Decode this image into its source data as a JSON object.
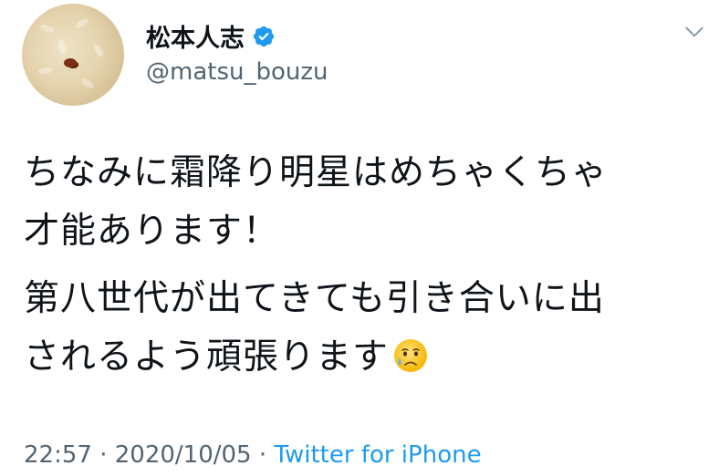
{
  "author": {
    "display_name": "松本人志",
    "handle": "@matsu_bouzu",
    "verified_icon": "verified-badge-icon",
    "avatar_icon": "avatar-image"
  },
  "menu": {
    "icon": "chevron-down-icon"
  },
  "tweet": {
    "paragraph_1_line_1": "ちなみに霜降り明星はめちゃくちゃ",
    "paragraph_1_line_2": "才能あります！",
    "paragraph_2_line_1": "第八世代が出てきても引き合いに出",
    "paragraph_2_line_2": "されるよう頑張ります",
    "emoji_icon": "crying-face-emoji"
  },
  "meta": {
    "time": "22:57",
    "separator_1": " · ",
    "date": "2020/10/05",
    "separator_2": " · ",
    "source": "Twitter for iPhone"
  },
  "colors": {
    "text": "#0f1419",
    "muted": "#536471",
    "link": "#1d9bf0",
    "verified": "#1d9bf0"
  }
}
